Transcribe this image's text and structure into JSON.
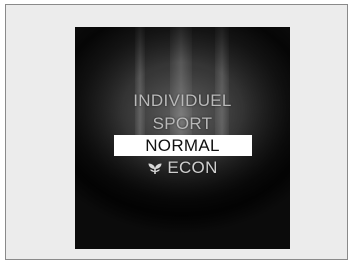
{
  "drive_mode_menu": {
    "items": [
      {
        "label": "INDIVIDUEL",
        "selected": false
      },
      {
        "label": "SPORT",
        "selected": false
      },
      {
        "label": "NORMAL",
        "selected": true
      },
      {
        "label": "ECON",
        "selected": false,
        "icon": "leaf-icon"
      }
    ]
  },
  "colors": {
    "frame_background": "#ececec",
    "screen_background": "#0e0e0e",
    "selected_highlight": "#ffffff",
    "menu_text": "#cfcfcf"
  }
}
